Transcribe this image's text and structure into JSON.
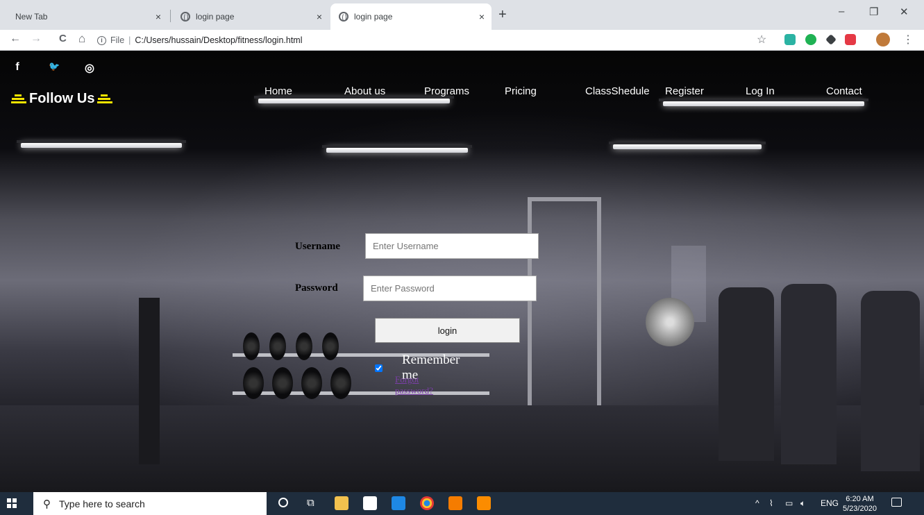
{
  "browser": {
    "tabs": [
      {
        "title": "New Tab",
        "close": "×"
      },
      {
        "title": "login page",
        "close": "×"
      },
      {
        "title": "login page",
        "close": "×"
      }
    ],
    "new_tab": "+",
    "window_controls": {
      "minimize": "–",
      "restore": "❐",
      "close": "✕"
    },
    "nav": {
      "back": "←",
      "forward": "→",
      "reload": "C",
      "home": "⌂"
    },
    "address": {
      "info": "i",
      "scheme": "File",
      "divider": "|",
      "url": "C:/Users/hussain/Desktop/fitness/login.html"
    },
    "bookmark_star": "☆",
    "menu_dots": "⋮"
  },
  "page": {
    "social": {
      "facebook": "f",
      "twitter": "🐦",
      "instagram": "◎"
    },
    "follow_us": "Follow Us",
    "menu": [
      "Home",
      "About us",
      "Programs",
      "Pricing",
      "ClassShedule",
      "Register",
      "Log In",
      "Contact"
    ],
    "form": {
      "username_label": "Username",
      "username_placeholder": "Enter Username",
      "password_label": "Password",
      "password_placeholder": "Enter Password",
      "login_button": "login",
      "remember_me": "Remember me",
      "remember_checked": true,
      "forgot_password": "Forgot password?"
    }
  },
  "taskbar": {
    "search_placeholder": "Type here to search",
    "tray": {
      "chevron": "^",
      "network": "⌇",
      "language": "ENG"
    },
    "time": "6:20 AM",
    "date": "5/23/2020"
  },
  "colors": {
    "accent_yellow": "#f5e400",
    "link_purple": "#7b3fa8",
    "taskbar": "#1f2d3d"
  }
}
